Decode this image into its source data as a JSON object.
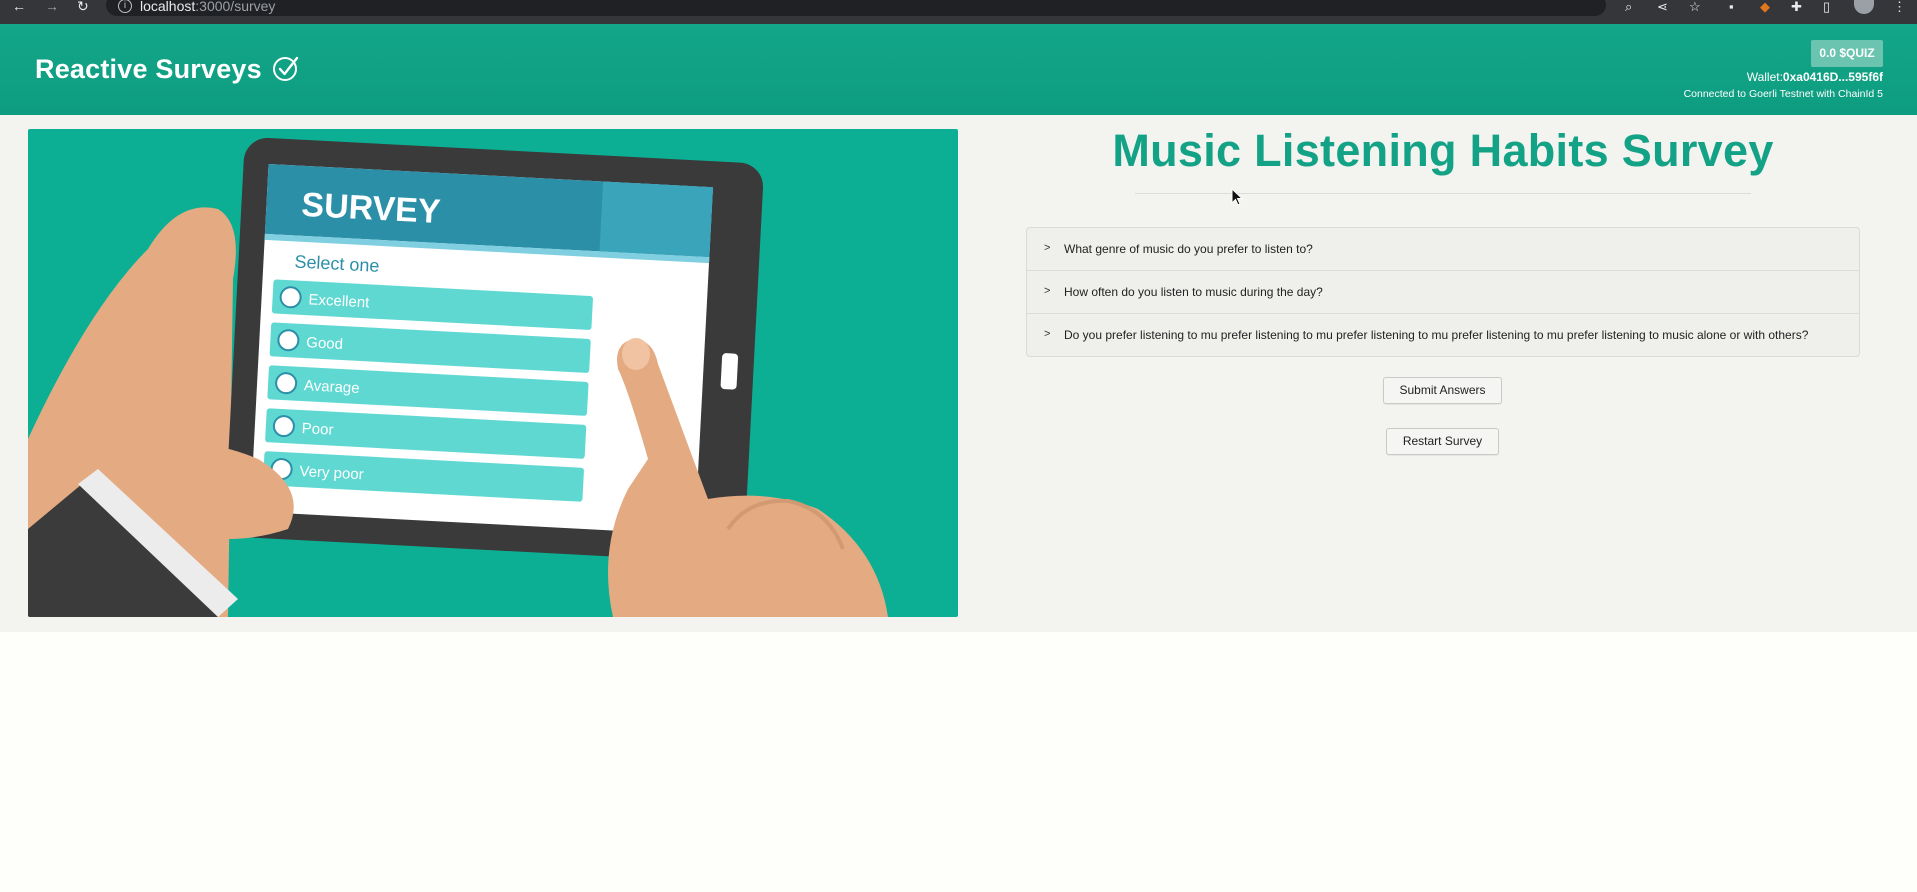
{
  "browser": {
    "url_host": "localhost",
    "url_path": ":3000/survey",
    "back_icon": "arrow-left-icon",
    "forward_icon": "arrow-right-icon",
    "reload_icon": "reload-icon"
  },
  "header": {
    "title": "Reactive Surveys ✅",
    "title_text": "Reactive Surveys",
    "title_mark": "✓",
    "token_balance": "0.0 $QUIZ",
    "wallet_label": "Wallet:",
    "wallet_address": "0xa0416D...595f6f",
    "network_status": "Connected to Goerli Testnet with ChainId 5"
  },
  "hero": {
    "screen_title": "SURVEY",
    "prompt": "Select one",
    "options": [
      "Excellent",
      "Good",
      "Avarage",
      "Poor",
      "Very poor"
    ]
  },
  "survey": {
    "title": "Music Listening Habits Survey",
    "questions": [
      "What genre of music do you prefer to listen to?",
      "How often do you listen to music during the day?",
      "Do you prefer listening to mu prefer listening to mu prefer listening to mu prefer listening to mu prefer listening to music alone or with others?"
    ],
    "submit_label": "Submit Answers",
    "restart_label": "Restart Survey"
  },
  "colors": {
    "brand": "#10a283",
    "title": "#13a286",
    "hero_bg": "#0daf94",
    "token_bg": "#6ac4b0"
  }
}
